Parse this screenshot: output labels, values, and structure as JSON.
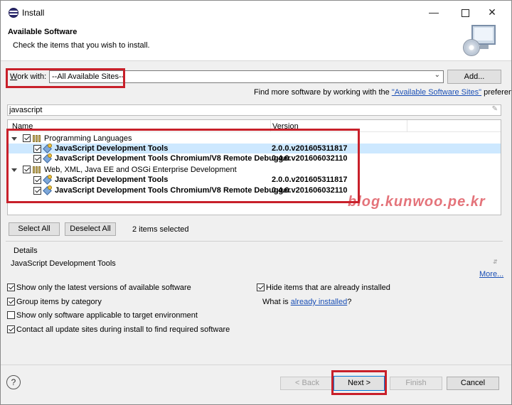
{
  "window": {
    "title": "Install"
  },
  "header": {
    "title": "Available Software",
    "subtitle": "Check the items that you wish to install."
  },
  "work_with": {
    "label": "Work with:",
    "value": "--All Available Sites--",
    "add_label": "Add..."
  },
  "find_more": {
    "prefix": "Find more software by working with the ",
    "link": "\"Available Software Sites\"",
    "suffix": " preferences."
  },
  "filter": {
    "value": "javascript"
  },
  "table": {
    "columns": [
      "Name",
      "Version"
    ],
    "groups": [
      {
        "label": "Programming Languages",
        "items": [
          {
            "name": "JavaScript Development Tools",
            "version": "2.0.0.v201605311817"
          },
          {
            "name": "JavaScript Development Tools Chromium/V8 Remote Debugger",
            "version": "0.4.0.v201606032110"
          }
        ]
      },
      {
        "label": "Web, XML, Java EE and OSGi Enterprise Development",
        "items": [
          {
            "name": "JavaScript Development Tools",
            "version": "2.0.0.v201605311817"
          },
          {
            "name": "JavaScript Development Tools Chromium/V8 Remote Debugger",
            "version": "0.4.0.v201606032110"
          }
        ]
      }
    ]
  },
  "watermark": "blog.kunwoo.pe.kr",
  "selection": {
    "select_all": "Select All",
    "deselect_all": "Deselect All",
    "status": "2 items selected"
  },
  "details": {
    "label": "Details",
    "text": "JavaScript Development Tools",
    "more": "More..."
  },
  "options": {
    "latest": "Show only the latest versions of available software",
    "hide_installed": "Hide items that are already installed",
    "group": "Group items by category",
    "what_is": "What is ",
    "already_installed": "already installed",
    "question": "?",
    "target_env": "Show only software applicable to target environment",
    "contact_all": "Contact all update sites during install to find required software"
  },
  "footer": {
    "back": "< Back",
    "next": "Next >",
    "finish": "Finish",
    "cancel": "Cancel",
    "help": "?"
  }
}
